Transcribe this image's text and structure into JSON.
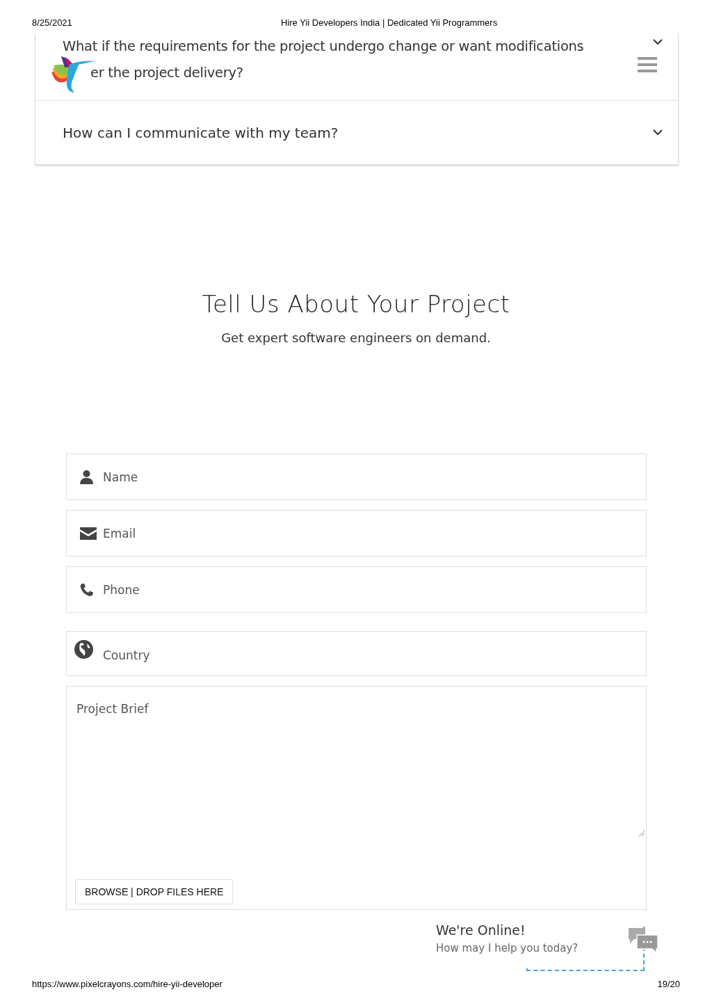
{
  "print_header": {
    "date": "8/25/2021",
    "title": "Hire Yii Developers India | Dedicated Yii Programmers"
  },
  "faq": [
    {
      "lines": [
        "What if the requirements for the project undergo change or want modifications",
        "er the project delivery?"
      ]
    },
    {
      "lines": [
        "How can I communicate with my team?"
      ]
    }
  ],
  "section": {
    "title": "Tell Us About Your Project",
    "subtitle": "Get expert software engineers on demand."
  },
  "form": {
    "fields": [
      {
        "kind": "name",
        "placeholder": "Name"
      },
      {
        "kind": "email",
        "placeholder": "Email"
      },
      {
        "kind": "phone",
        "placeholder": "Phone"
      },
      {
        "kind": "country",
        "placeholder": "Country"
      }
    ],
    "brief": {
      "placeholder": "Project Brief"
    },
    "upload_button": "BROWSE | DROP FILES HERE"
  },
  "chat": {
    "title": "We're Online!",
    "subtitle": "How may I help you today?"
  },
  "print_footer": {
    "url": "https://www.pixelcrayons.com/hire-yii-developer",
    "page": "19/20"
  }
}
